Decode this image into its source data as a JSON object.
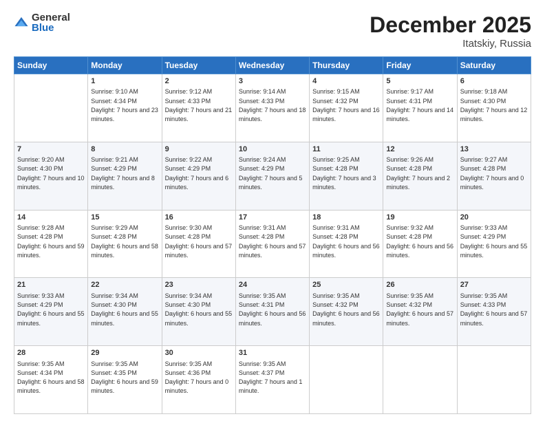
{
  "header": {
    "logo_general": "General",
    "logo_blue": "Blue",
    "month_title": "December 2025",
    "location": "Itatskiy, Russia"
  },
  "columns": [
    "Sunday",
    "Monday",
    "Tuesday",
    "Wednesday",
    "Thursday",
    "Friday",
    "Saturday"
  ],
  "weeks": [
    [
      {
        "day": "",
        "sunrise": "",
        "sunset": "",
        "daylight": ""
      },
      {
        "day": "1",
        "sunrise": "Sunrise: 9:10 AM",
        "sunset": "Sunset: 4:34 PM",
        "daylight": "Daylight: 7 hours and 23 minutes."
      },
      {
        "day": "2",
        "sunrise": "Sunrise: 9:12 AM",
        "sunset": "Sunset: 4:33 PM",
        "daylight": "Daylight: 7 hours and 21 minutes."
      },
      {
        "day": "3",
        "sunrise": "Sunrise: 9:14 AM",
        "sunset": "Sunset: 4:33 PM",
        "daylight": "Daylight: 7 hours and 18 minutes."
      },
      {
        "day": "4",
        "sunrise": "Sunrise: 9:15 AM",
        "sunset": "Sunset: 4:32 PM",
        "daylight": "Daylight: 7 hours and 16 minutes."
      },
      {
        "day": "5",
        "sunrise": "Sunrise: 9:17 AM",
        "sunset": "Sunset: 4:31 PM",
        "daylight": "Daylight: 7 hours and 14 minutes."
      },
      {
        "day": "6",
        "sunrise": "Sunrise: 9:18 AM",
        "sunset": "Sunset: 4:30 PM",
        "daylight": "Daylight: 7 hours and 12 minutes."
      }
    ],
    [
      {
        "day": "7",
        "sunrise": "Sunrise: 9:20 AM",
        "sunset": "Sunset: 4:30 PM",
        "daylight": "Daylight: 7 hours and 10 minutes."
      },
      {
        "day": "8",
        "sunrise": "Sunrise: 9:21 AM",
        "sunset": "Sunset: 4:29 PM",
        "daylight": "Daylight: 7 hours and 8 minutes."
      },
      {
        "day": "9",
        "sunrise": "Sunrise: 9:22 AM",
        "sunset": "Sunset: 4:29 PM",
        "daylight": "Daylight: 7 hours and 6 minutes."
      },
      {
        "day": "10",
        "sunrise": "Sunrise: 9:24 AM",
        "sunset": "Sunset: 4:29 PM",
        "daylight": "Daylight: 7 hours and 5 minutes."
      },
      {
        "day": "11",
        "sunrise": "Sunrise: 9:25 AM",
        "sunset": "Sunset: 4:28 PM",
        "daylight": "Daylight: 7 hours and 3 minutes."
      },
      {
        "day": "12",
        "sunrise": "Sunrise: 9:26 AM",
        "sunset": "Sunset: 4:28 PM",
        "daylight": "Daylight: 7 hours and 2 minutes."
      },
      {
        "day": "13",
        "sunrise": "Sunrise: 9:27 AM",
        "sunset": "Sunset: 4:28 PM",
        "daylight": "Daylight: 7 hours and 0 minutes."
      }
    ],
    [
      {
        "day": "14",
        "sunrise": "Sunrise: 9:28 AM",
        "sunset": "Sunset: 4:28 PM",
        "daylight": "Daylight: 6 hours and 59 minutes."
      },
      {
        "day": "15",
        "sunrise": "Sunrise: 9:29 AM",
        "sunset": "Sunset: 4:28 PM",
        "daylight": "Daylight: 6 hours and 58 minutes."
      },
      {
        "day": "16",
        "sunrise": "Sunrise: 9:30 AM",
        "sunset": "Sunset: 4:28 PM",
        "daylight": "Daylight: 6 hours and 57 minutes."
      },
      {
        "day": "17",
        "sunrise": "Sunrise: 9:31 AM",
        "sunset": "Sunset: 4:28 PM",
        "daylight": "Daylight: 6 hours and 57 minutes."
      },
      {
        "day": "18",
        "sunrise": "Sunrise: 9:31 AM",
        "sunset": "Sunset: 4:28 PM",
        "daylight": "Daylight: 6 hours and 56 minutes."
      },
      {
        "day": "19",
        "sunrise": "Sunrise: 9:32 AM",
        "sunset": "Sunset: 4:28 PM",
        "daylight": "Daylight: 6 hours and 56 minutes."
      },
      {
        "day": "20",
        "sunrise": "Sunrise: 9:33 AM",
        "sunset": "Sunset: 4:29 PM",
        "daylight": "Daylight: 6 hours and 55 minutes."
      }
    ],
    [
      {
        "day": "21",
        "sunrise": "Sunrise: 9:33 AM",
        "sunset": "Sunset: 4:29 PM",
        "daylight": "Daylight: 6 hours and 55 minutes."
      },
      {
        "day": "22",
        "sunrise": "Sunrise: 9:34 AM",
        "sunset": "Sunset: 4:30 PM",
        "daylight": "Daylight: 6 hours and 55 minutes."
      },
      {
        "day": "23",
        "sunrise": "Sunrise: 9:34 AM",
        "sunset": "Sunset: 4:30 PM",
        "daylight": "Daylight: 6 hours and 55 minutes."
      },
      {
        "day": "24",
        "sunrise": "Sunrise: 9:35 AM",
        "sunset": "Sunset: 4:31 PM",
        "daylight": "Daylight: 6 hours and 56 minutes."
      },
      {
        "day": "25",
        "sunrise": "Sunrise: 9:35 AM",
        "sunset": "Sunset: 4:32 PM",
        "daylight": "Daylight: 6 hours and 56 minutes."
      },
      {
        "day": "26",
        "sunrise": "Sunrise: 9:35 AM",
        "sunset": "Sunset: 4:32 PM",
        "daylight": "Daylight: 6 hours and 57 minutes."
      },
      {
        "day": "27",
        "sunrise": "Sunrise: 9:35 AM",
        "sunset": "Sunset: 4:33 PM",
        "daylight": "Daylight: 6 hours and 57 minutes."
      }
    ],
    [
      {
        "day": "28",
        "sunrise": "Sunrise: 9:35 AM",
        "sunset": "Sunset: 4:34 PM",
        "daylight": "Daylight: 6 hours and 58 minutes."
      },
      {
        "day": "29",
        "sunrise": "Sunrise: 9:35 AM",
        "sunset": "Sunset: 4:35 PM",
        "daylight": "Daylight: 6 hours and 59 minutes."
      },
      {
        "day": "30",
        "sunrise": "Sunrise: 9:35 AM",
        "sunset": "Sunset: 4:36 PM",
        "daylight": "Daylight: 7 hours and 0 minutes."
      },
      {
        "day": "31",
        "sunrise": "Sunrise: 9:35 AM",
        "sunset": "Sunset: 4:37 PM",
        "daylight": "Daylight: 7 hours and 1 minute."
      },
      {
        "day": "",
        "sunrise": "",
        "sunset": "",
        "daylight": ""
      },
      {
        "day": "",
        "sunrise": "",
        "sunset": "",
        "daylight": ""
      },
      {
        "day": "",
        "sunrise": "",
        "sunset": "",
        "daylight": ""
      }
    ]
  ]
}
